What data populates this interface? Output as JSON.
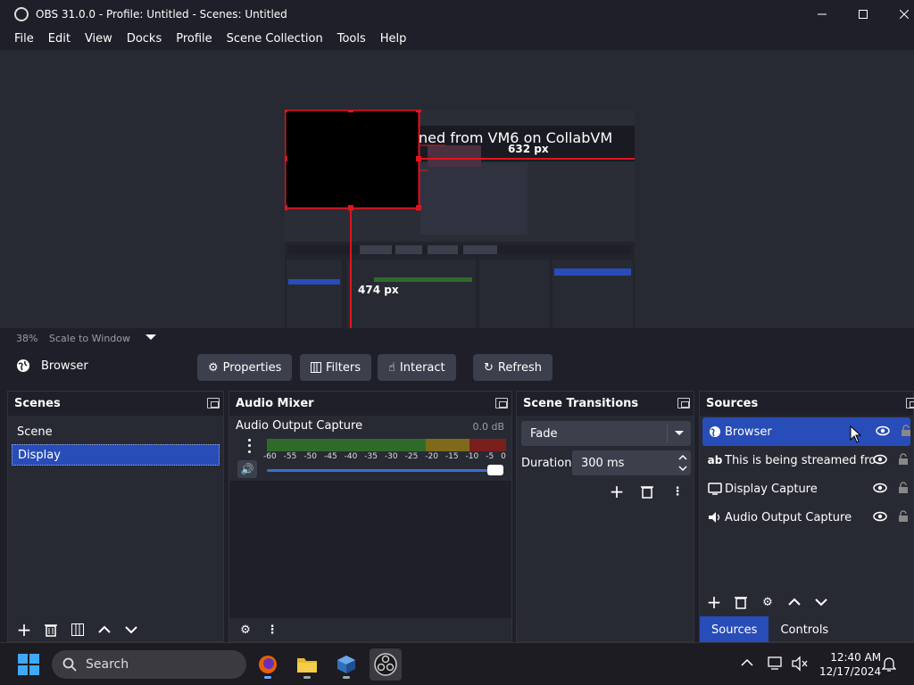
{
  "window": {
    "title": "OBS 31.0.0 - Profile: Untitled - Scenes: Untitled"
  },
  "menu": [
    "File",
    "Edit",
    "View",
    "Docks",
    "Profile",
    "Scene Collection",
    "Tools",
    "Help"
  ],
  "preview": {
    "overlay_text": "ned from VM6 on CollabVM",
    "width_label": "632 px",
    "height_label": "474 px"
  },
  "zoombar": {
    "zoom": "38%",
    "mode": "Scale to Window"
  },
  "source_toolbar": {
    "selected_source": "Browser",
    "properties": "Properties",
    "filters": "Filters",
    "interact": "Interact",
    "refresh": "Refresh"
  },
  "scenes": {
    "title": "Scenes",
    "items": [
      "Scene",
      "Display"
    ],
    "selected": "Display"
  },
  "mixer": {
    "title": "Audio Mixer",
    "channel": {
      "name": "Audio Output Capture",
      "db": "0.0 dB",
      "ticks": [
        "-60",
        "-55",
        "-50",
        "-45",
        "-40",
        "-35",
        "-30",
        "-25",
        "-20",
        "-15",
        "-10",
        "-5",
        "0"
      ],
      "volume": 1.0
    }
  },
  "transitions": {
    "title": "Scene Transitions",
    "selected": "Fade",
    "duration_label": "Duration",
    "duration_value": "300 ms"
  },
  "sources": {
    "title": "Sources",
    "items": [
      {
        "label": "Browser",
        "icon": "globe-icon"
      },
      {
        "label": "This is being streamed from",
        "icon": "text-icon"
      },
      {
        "label": "Display Capture",
        "icon": "monitor-icon"
      },
      {
        "label": "Audio Output Capture",
        "icon": "speaker-icon"
      }
    ],
    "tabs": [
      "Sources",
      "Controls"
    ]
  },
  "taskbar": {
    "search": "Search",
    "time": "12:40 AM",
    "date": "12/17/2024"
  },
  "colors": {
    "accent": "#284cb8",
    "bg": "#1e1f28",
    "panel": "#272a33",
    "selection_red": "#e0141e"
  }
}
